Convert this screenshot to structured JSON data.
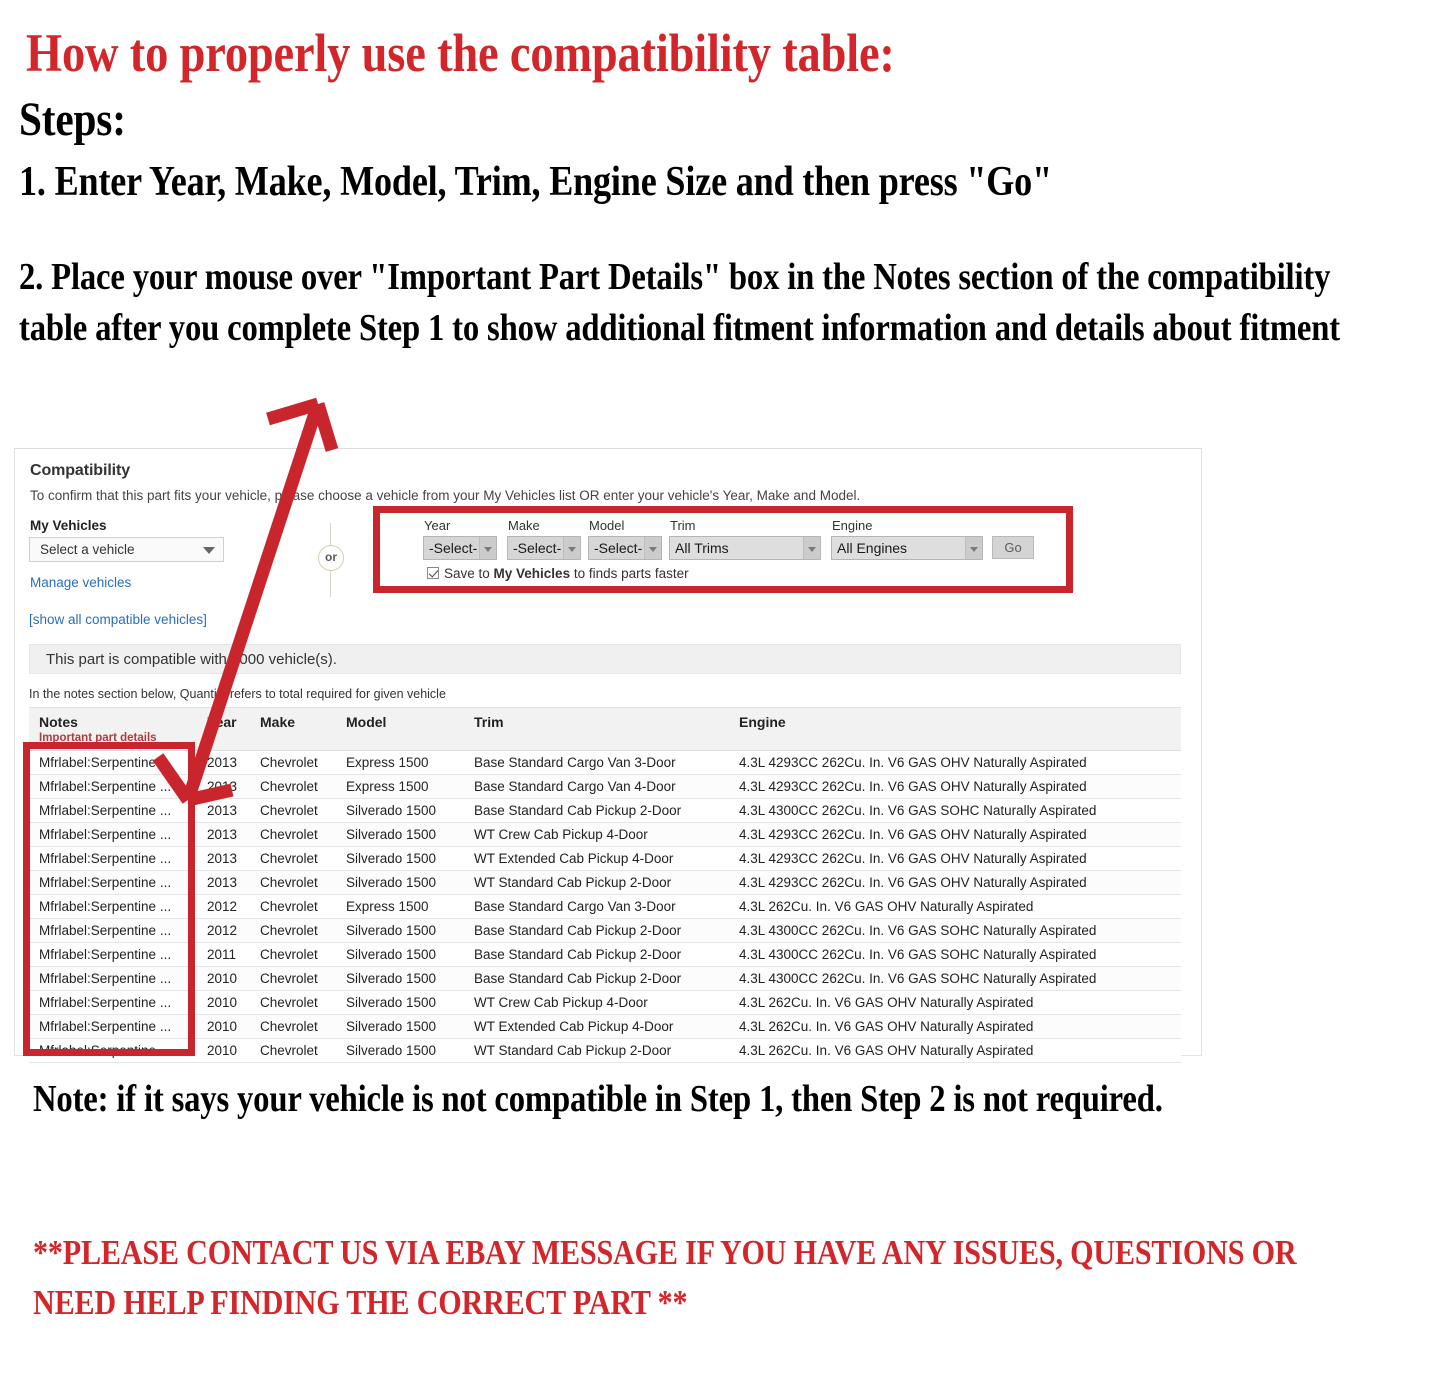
{
  "instructions": {
    "title": "How to properly use the compatibility table:",
    "steps_label": "Steps:",
    "step_1": "1. Enter Year, Make, Model, Trim, Engine Size and then press \"Go\"",
    "step_2": "2. Place your mouse over \"Important Part Details\" box in the Notes section of the compatibility table after you complete Step 1 to show additional fitment information and details about fitment",
    "note": "Note: if it says your vehicle is not compatible in Step 1, then Step 2 is not required.",
    "contact": "**PLEASE CONTACT US VIA EBAY MESSAGE IF YOU HAVE ANY ISSUES, QUESTIONS OR NEED HELP FINDING THE CORRECT PART **"
  },
  "colors": {
    "accent_red": "#d3262b",
    "highlight_box_red": "#c9252d",
    "link_blue": "#2a6ebb",
    "notes_sub_red": "#b23a3a"
  },
  "compatibility": {
    "title": "Compatibility",
    "subtitle": "To confirm that this part fits your vehicle, please choose a vehicle from your My Vehicles list OR enter your vehicle's Year, Make and Model.",
    "my_vehicles_label": "My Vehicles",
    "vehicle_select_value": "Select a vehicle",
    "manage_vehicles_link": "Manage vehicles",
    "show_all_link": "[show all compatible vehicles]",
    "or_label": "or",
    "count_message": "This part is compatible with 1000 vehicle(s).",
    "quantity_note": "In the notes section below, Quantity refers to total required for given vehicle",
    "form": {
      "year": {
        "label": "Year",
        "value": "-Select-"
      },
      "make": {
        "label": "Make",
        "value": "-Select-"
      },
      "model": {
        "label": "Model",
        "value": "-Select-"
      },
      "trim": {
        "label": "Trim",
        "value": "All Trims"
      },
      "engine": {
        "label": "Engine",
        "value": "All Engines"
      },
      "go_label": "Go",
      "save_prefix": "Save to ",
      "save_bold": "My Vehicles",
      "save_suffix": " to finds parts faster"
    },
    "table": {
      "headers": {
        "notes": "Notes",
        "notes_sub": "Important part details",
        "year": "Year",
        "make": "Make",
        "model": "Model",
        "trim": "Trim",
        "engine": "Engine"
      },
      "rows": [
        {
          "notes": "Mfrlabel:Serpentine ...",
          "year": "2013",
          "make": "Chevrolet",
          "model": "Express 1500",
          "trim": "Base Standard Cargo Van 3-Door",
          "engine": "4.3L 4293CC 262Cu. In. V6 GAS OHV Naturally Aspirated"
        },
        {
          "notes": "Mfrlabel:Serpentine ...",
          "year": "2013",
          "make": "Chevrolet",
          "model": "Express 1500",
          "trim": "Base Standard Cargo Van 4-Door",
          "engine": "4.3L 4293CC 262Cu. In. V6 GAS OHV Naturally Aspirated"
        },
        {
          "notes": "Mfrlabel:Serpentine ...",
          "year": "2013",
          "make": "Chevrolet",
          "model": "Silverado 1500",
          "trim": "Base Standard Cab Pickup 2-Door",
          "engine": "4.3L 4300CC 262Cu. In. V6 GAS SOHC Naturally Aspirated"
        },
        {
          "notes": "Mfrlabel:Serpentine ...",
          "year": "2013",
          "make": "Chevrolet",
          "model": "Silverado 1500",
          "trim": "WT Crew Cab Pickup 4-Door",
          "engine": "4.3L 4293CC 262Cu. In. V6 GAS OHV Naturally Aspirated"
        },
        {
          "notes": "Mfrlabel:Serpentine ...",
          "year": "2013",
          "make": "Chevrolet",
          "model": "Silverado 1500",
          "trim": "WT Extended Cab Pickup 4-Door",
          "engine": "4.3L 4293CC 262Cu. In. V6 GAS OHV Naturally Aspirated"
        },
        {
          "notes": "Mfrlabel:Serpentine ...",
          "year": "2013",
          "make": "Chevrolet",
          "model": "Silverado 1500",
          "trim": "WT Standard Cab Pickup 2-Door",
          "engine": "4.3L 4293CC 262Cu. In. V6 GAS OHV Naturally Aspirated"
        },
        {
          "notes": "Mfrlabel:Serpentine ...",
          "year": "2012",
          "make": "Chevrolet",
          "model": "Express 1500",
          "trim": "Base Standard Cargo Van 3-Door",
          "engine": "4.3L 262Cu. In. V6 GAS OHV Naturally Aspirated"
        },
        {
          "notes": "Mfrlabel:Serpentine ...",
          "year": "2012",
          "make": "Chevrolet",
          "model": "Silverado 1500",
          "trim": "Base Standard Cab Pickup 2-Door",
          "engine": "4.3L 4300CC 262Cu. In. V6 GAS SOHC Naturally Aspirated"
        },
        {
          "notes": "Mfrlabel:Serpentine ...",
          "year": "2011",
          "make": "Chevrolet",
          "model": "Silverado 1500",
          "trim": "Base Standard Cab Pickup 2-Door",
          "engine": "4.3L 4300CC 262Cu. In. V6 GAS SOHC Naturally Aspirated"
        },
        {
          "notes": "Mfrlabel:Serpentine ...",
          "year": "2010",
          "make": "Chevrolet",
          "model": "Silverado 1500",
          "trim": "Base Standard Cab Pickup 2-Door",
          "engine": "4.3L 4300CC 262Cu. In. V6 GAS SOHC Naturally Aspirated"
        },
        {
          "notes": "Mfrlabel:Serpentine ...",
          "year": "2010",
          "make": "Chevrolet",
          "model": "Silverado 1500",
          "trim": "WT Crew Cab Pickup 4-Door",
          "engine": "4.3L 262Cu. In. V6 GAS OHV Naturally Aspirated"
        },
        {
          "notes": "Mfrlabel:Serpentine ...",
          "year": "2010",
          "make": "Chevrolet",
          "model": "Silverado 1500",
          "trim": "WT Extended Cab Pickup 4-Door",
          "engine": "4.3L 262Cu. In. V6 GAS OHV Naturally Aspirated"
        },
        {
          "notes": "Mfrlabel:Serpentine ...",
          "year": "2010",
          "make": "Chevrolet",
          "model": "Silverado 1500",
          "trim": "WT Standard Cab Pickup 2-Door",
          "engine": "4.3L 262Cu. In. V6 GAS OHV Naturally Aspirated"
        }
      ]
    }
  }
}
